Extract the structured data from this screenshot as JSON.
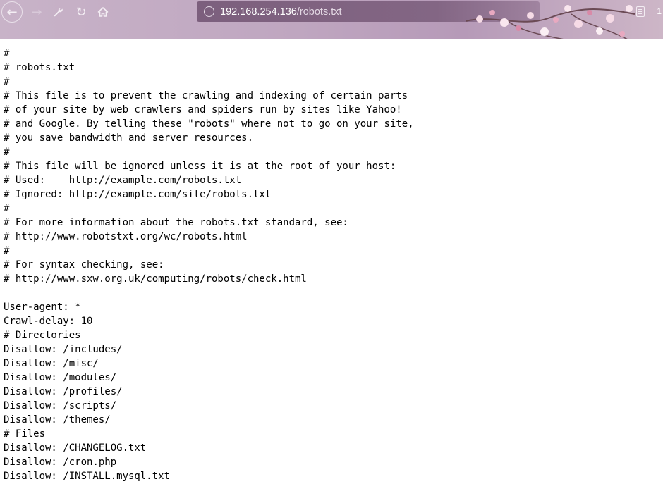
{
  "browser": {
    "url_host": "192.168.254.136",
    "url_path": "/robots.txt",
    "tab_count": "1",
    "icons": {
      "back": "back-arrow-icon",
      "forward": "forward-arrow-icon",
      "tools": "wrench-icon",
      "reload": "reload-icon",
      "home": "home-icon",
      "site_info": "info-icon",
      "reader": "reader-mode-icon"
    }
  },
  "document": {
    "lines": [
      "#",
      "# robots.txt",
      "#",
      "# This file is to prevent the crawling and indexing of certain parts",
      "# of your site by web crawlers and spiders run by sites like Yahoo!",
      "# and Google. By telling these \"robots\" where not to go on your site,",
      "# you save bandwidth and server resources.",
      "#",
      "# This file will be ignored unless it is at the root of your host:",
      "# Used:    http://example.com/robots.txt",
      "# Ignored: http://example.com/site/robots.txt",
      "#",
      "# For more information about the robots.txt standard, see:",
      "# http://www.robotstxt.org/wc/robots.html",
      "#",
      "# For syntax checking, see:",
      "# http://www.sxw.org.uk/computing/robots/check.html",
      "",
      "User-agent: *",
      "Crawl-delay: 10",
      "# Directories",
      "Disallow: /includes/",
      "Disallow: /misc/",
      "Disallow: /modules/",
      "Disallow: /profiles/",
      "Disallow: /scripts/",
      "Disallow: /themes/",
      "# Files",
      "Disallow: /CHANGELOG.txt",
      "Disallow: /cron.php",
      "Disallow: /INSTALL.mysql.txt"
    ]
  }
}
